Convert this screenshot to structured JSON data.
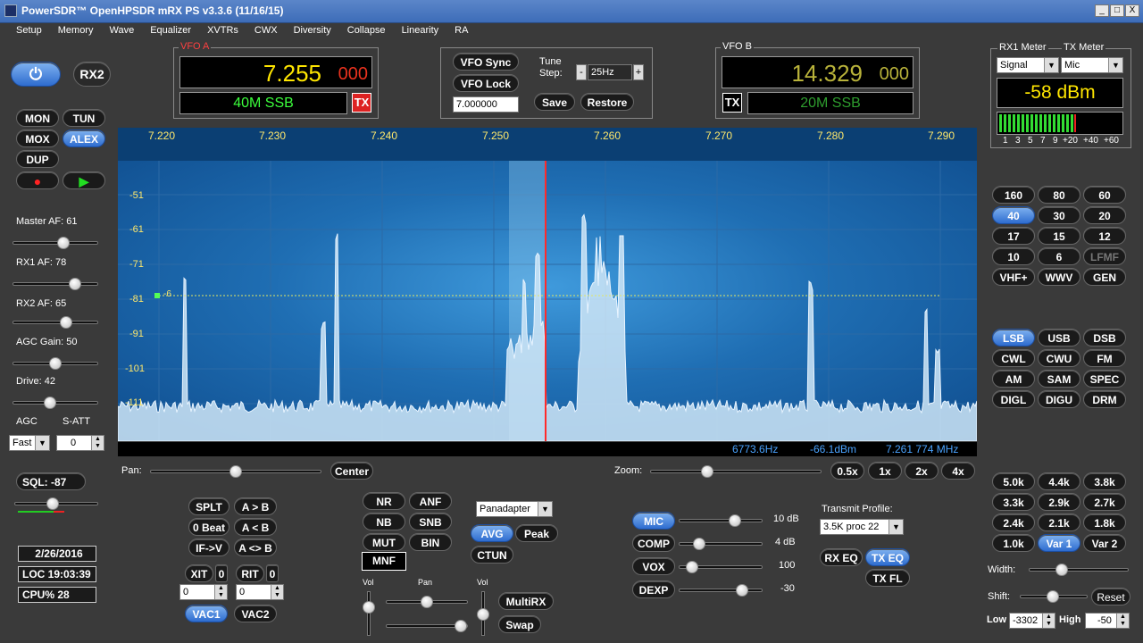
{
  "window": {
    "title": "PowerSDR™ OpenHPSDR mRX PS v3.3.6 (11/16/15)",
    "controls": [
      "_",
      "□",
      "X"
    ]
  },
  "menu": [
    "Setup",
    "Memory",
    "Wave",
    "Equalizer",
    "XVTRs",
    "CWX",
    "Diversity",
    "Collapse",
    "Linearity",
    "RA"
  ],
  "left": {
    "rx2": "RX2",
    "mon": "MON",
    "tun": "TUN",
    "mox": "MOX",
    "alex": "ALEX",
    "dup": "DUP",
    "master_af": "Master AF:  61",
    "master_af_level": 61,
    "rx1_af": "RX1 AF:  78",
    "rx1_af_level": 78,
    "rx2_af": "RX2 AF:  65",
    "rx2_af_level": 65,
    "agc_gain": "AGC Gain:  50",
    "agc_gain_level": 50,
    "drive": "Drive:  42",
    "drive_level": 42,
    "agc": "AGC",
    "satt": "S-ATT",
    "agc_mode": "Fast",
    "satt_value": "0",
    "sql": "SQL: -87",
    "date": "2/26/2016",
    "loc_time": "LOC 19:03:39",
    "cpu": "CPU%  28"
  },
  "vfoa": {
    "title": "VFO A",
    "freq_main": "7.255",
    "freq_sub": "000",
    "band_mode": "40M SSB",
    "tx": "TX"
  },
  "center_box": {
    "vfo_sync": "VFO Sync",
    "vfo_lock": "VFO Lock",
    "tune_step_label": "Tune Step:",
    "tune_step": "25Hz",
    "minus": "-",
    "plus": "+",
    "freq_input": "7.000000",
    "save": "Save",
    "restore": "Restore"
  },
  "vfob": {
    "title": "VFO B",
    "freq_main": "14.329",
    "freq_sub": "000",
    "band_mode": "20M SSB",
    "tx": "TX"
  },
  "meter": {
    "rx1_title": "RX1 Meter",
    "tx_title": "TX Meter",
    "rx1_mode": "Signal",
    "tx_mode": "Mic",
    "reading": "-58 dBm",
    "scale": [
      "1",
      "3",
      "5",
      "7",
      "9",
      "+20",
      "+40",
      "+60"
    ]
  },
  "spectrum": {
    "freq_labels": [
      "7.220",
      "7.230",
      "7.240",
      "7.250",
      "7.260",
      "7.270",
      "7.280",
      "7.290"
    ],
    "db_labels": [
      "-51",
      "-61",
      "-71",
      "-81",
      "-91",
      "-101",
      "-111"
    ],
    "squelch_marker": "-6",
    "status_hz": "6773.6Hz",
    "status_dbm": "-66.1dBm",
    "status_mhz": "7.261 774 MHz",
    "colors": {
      "trace": "#cfe6f7",
      "cursor": "#ff2a2a",
      "filter": "#9ad0f2"
    }
  },
  "pan_zoom": {
    "pan": "Pan:",
    "center": "Center",
    "zoom": "Zoom:",
    "zooms": [
      "0.5x",
      "1x",
      "2x",
      "4x"
    ]
  },
  "bands": [
    "160",
    "80",
    "60",
    "40",
    "30",
    "20",
    "17",
    "15",
    "12",
    "10",
    "6",
    "LFMF",
    "VHF+",
    "WWV",
    "GEN"
  ],
  "modes": [
    "LSB",
    "USB",
    "DSB",
    "CWL",
    "CWU",
    "FM",
    "AM",
    "SAM",
    "SPEC",
    "DIGL",
    "DIGU",
    "DRM"
  ],
  "filters": [
    "5.0k",
    "4.4k",
    "3.8k",
    "3.3k",
    "2.9k",
    "2.7k",
    "2.4k",
    "2.1k",
    "1.8k",
    "1.0k",
    "Var 1",
    "Var 2"
  ],
  "filter_bottom": {
    "width": "Width:",
    "shift": "Shift:",
    "reset": "Reset",
    "low_label": "Low",
    "low": "-3302",
    "high_label": "High",
    "high": "-50"
  },
  "split": {
    "splt": "SPLT",
    "atob": "A > B",
    "zerobeat": "0 Beat",
    "btoa": "A < B",
    "ifv": "IF->V",
    "swap": "A <> B",
    "xit": "XIT",
    "xit_val": "0",
    "rit": "RIT",
    "rit_val": "0",
    "xit_spin": "0",
    "rit_spin": "0",
    "vac1": "VAC1",
    "vac2": "VAC2"
  },
  "dsp": {
    "nr": "NR",
    "anf": "ANF",
    "nb": "NB",
    "snb": "SNB",
    "mut": "MUT",
    "bin": "BIN",
    "mnf": "MNF",
    "display_mode": "Panadapter",
    "avg": "AVG",
    "peak": "Peak",
    "ctun": "CTUN",
    "vol": "Vol",
    "pan": "Pan",
    "vol2": "Vol",
    "multirx": "MultiRX",
    "swap": "Swap"
  },
  "tx": {
    "mic": "MIC",
    "mic_val": "10 dB",
    "comp": "COMP",
    "comp_val": "4 dB",
    "vox": "VOX",
    "vox_val": "100",
    "dexp": "DEXP",
    "dexp_val": "-30",
    "profile_label": "Transmit Profile:",
    "profile": "3.5K proc 22",
    "rx_eq": "RX EQ",
    "tx_eq": "TX EQ",
    "tx_fl": "TX FL"
  }
}
